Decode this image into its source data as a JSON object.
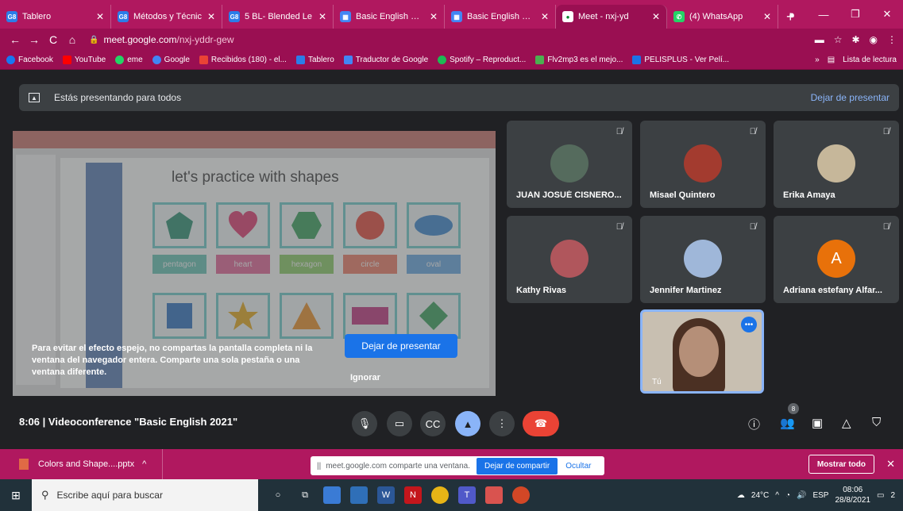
{
  "tabs": [
    {
      "label": "Tablero",
      "fav_text": "G8",
      "fav_color": "#2b7de9"
    },
    {
      "label": "Métodos y Técnic",
      "fav_text": "G8",
      "fav_color": "#2b7de9"
    },
    {
      "label": "5 BL- Blended Le",
      "fav_text": "G8",
      "fav_color": "#2b7de9"
    },
    {
      "label": "Basic English Clas",
      "fav_text": "▦",
      "fav_color": "#4285f4"
    },
    {
      "label": "Basic English Clas",
      "fav_text": "▦",
      "fav_color": "#4285f4"
    },
    {
      "label": "Meet - nxj-yd",
      "fav_text": "●",
      "fav_color": "#00832d"
    },
    {
      "label": "(4) WhatsApp",
      "fav_text": "✆",
      "fav_color": "#25d366"
    }
  ],
  "new_tab": "+",
  "address": {
    "host": "meet.google.com",
    "path": "/nxj-yddr-gew"
  },
  "bookmarks": [
    {
      "label": "Facebook",
      "color": "#1877f2"
    },
    {
      "label": "YouTube",
      "color": "#ff0000"
    },
    {
      "label": "eme",
      "color": "#25d366"
    },
    {
      "label": "Google",
      "color": "#4285f4"
    },
    {
      "label": "Recibidos (180) - el...",
      "color": "#ea4335"
    },
    {
      "label": "Tablero",
      "color": "#2b7de9"
    },
    {
      "label": "Traductor de Google",
      "color": "#4285f4"
    },
    {
      "label": "Spotify – Reproduct...",
      "color": "#1db954"
    },
    {
      "label": "Flv2mp3 es el mejo...",
      "color": "#4caf50"
    },
    {
      "label": "PELISPLUS - Ver Pelí...",
      "color": "#1a73e8"
    }
  ],
  "bookmarks_more": "»",
  "reading_list": "Lista de lectura",
  "banner": {
    "text": "Estás presentando para todos",
    "stop": "Dejar de presentar"
  },
  "slide": {
    "title": "let's practice with shapes",
    "labels": [
      "pentagon",
      "heart",
      "hexagon",
      "circle",
      "oval"
    ],
    "label_colors": [
      "#5bb7a8",
      "#d65a8c",
      "#7fbf5a",
      "#e0705a",
      "#5b9bd5"
    ]
  },
  "warning": "Para evitar el efecto espejo, no compartas la pantalla completa ni la ventana del navegador entera. Comparte una sola pestaña o una ventana diferente.",
  "stop_present_btn": "Dejar de presentar",
  "ignore_btn": "Ignorar",
  "participants": [
    {
      "name": "JUAN JOSUÉ CISNERO...",
      "avatar_color": "#556b5d"
    },
    {
      "name": "Misael Quintero",
      "avatar_color": "#a33b2f"
    },
    {
      "name": "Erika Amaya",
      "avatar_color": "#c6b79a"
    },
    {
      "name": "Kathy Rivas",
      "avatar_color": "#b0565c"
    },
    {
      "name": "Jennifer Martinez",
      "avatar_color": "#9fb7d9"
    },
    {
      "name": "Adriana estefany Alfar...",
      "avatar_letter": "A"
    }
  ],
  "self_label": "Tú",
  "meeting": {
    "time": "8:06",
    "separator": "|",
    "title": "Videoconference \"Basic English 2021\""
  },
  "people_count": "8",
  "downloads": {
    "file": "Colors and Shape....pptx",
    "share_text": "meet.google.com comparte una ventana.",
    "share_stop": "Dejar de compartir",
    "share_hide": "Ocultar",
    "show_all": "Mostrar todo"
  },
  "taskbar": {
    "search_placeholder": "Escribe aquí para buscar",
    "weather": "24°C",
    "lang": "ESP",
    "time": "08:06",
    "date": "28/8/2021",
    "notif": "2"
  }
}
